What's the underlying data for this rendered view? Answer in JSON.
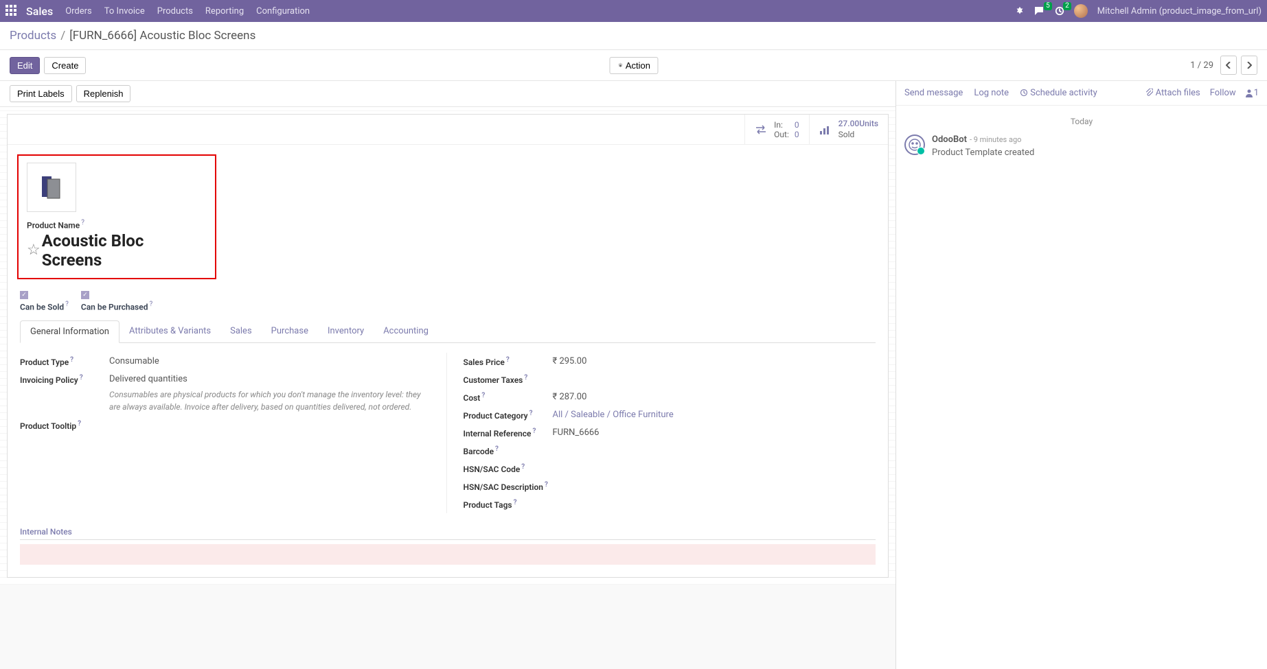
{
  "topnav": {
    "brand": "Sales",
    "menus": [
      "Orders",
      "To Invoice",
      "Products",
      "Reporting",
      "Configuration"
    ],
    "msg_badge": "5",
    "act_badge": "2",
    "user": "Mitchell Admin (product_image_from_url)"
  },
  "breadcrumb": {
    "root": "Products",
    "current": "[FURN_6666] Acoustic Bloc Screens"
  },
  "controls": {
    "edit": "Edit",
    "create": "Create",
    "action": "Action",
    "pager": "1 / 29"
  },
  "subbar": {
    "print_labels": "Print Labels",
    "replenish": "Replenish"
  },
  "stats": {
    "in_label": "In:",
    "in_val": "0",
    "out_label": "Out:",
    "out_val": "0",
    "sold_qty": "27.00",
    "sold_unit": "Units",
    "sold_label": "Sold"
  },
  "product": {
    "name_label": "Product Name",
    "name": "Acoustic Bloc Screens",
    "can_be_sold": "Can be Sold",
    "can_be_purchased": "Can be Purchased"
  },
  "tabs": [
    "General Information",
    "Attributes & Variants",
    "Sales",
    "Purchase",
    "Inventory",
    "Accounting"
  ],
  "fields_left": {
    "product_type_l": "Product Type",
    "product_type_v": "Consumable",
    "invoicing_policy_l": "Invoicing Policy",
    "invoicing_policy_v": "Delivered quantities",
    "invoicing_help": "Consumables are physical products for which you don't manage the inventory level: they are always available. Invoice after delivery, based on quantities delivered, not ordered.",
    "product_tooltip_l": "Product Tooltip"
  },
  "fields_right": {
    "sales_price_l": "Sales Price",
    "sales_price_v": "₹ 295.00",
    "customer_taxes_l": "Customer Taxes",
    "cost_l": "Cost",
    "cost_v": "₹ 287.00",
    "product_category_l": "Product Category",
    "product_category_v": "All / Saleable / Office Furniture",
    "internal_ref_l": "Internal Reference",
    "internal_ref_v": "FURN_6666",
    "barcode_l": "Barcode",
    "hsn_code_l": "HSN/SAC Code",
    "hsn_desc_l": "HSN/SAC Description",
    "product_tags_l": "Product Tags"
  },
  "notes": {
    "title": "Internal Notes"
  },
  "chatter": {
    "send": "Send message",
    "log": "Log note",
    "schedule": "Schedule activity",
    "attach": "Attach files",
    "follow": "Follow",
    "follower_count": "1",
    "today": "Today",
    "bot_name": "OdooBot",
    "bot_time": "- 9 minutes ago",
    "bot_msg": "Product Template created"
  }
}
